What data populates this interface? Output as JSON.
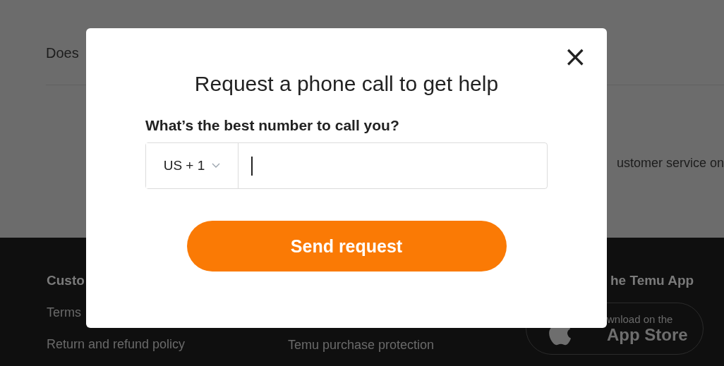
{
  "background": {
    "question": "Does",
    "snippet": "ustomer service on"
  },
  "footer": {
    "heading_1": "Custo",
    "links_1": [
      "Terms",
      "Return and refund policy"
    ],
    "links_2": [
      "Temu purchase protection"
    ],
    "heading_3": "he Temu App",
    "app_badge": {
      "caption": "wnload on the",
      "store": "App Store"
    }
  },
  "dialog": {
    "close": "×",
    "title": "Request a phone call to get help",
    "field_label": "What’s the best number to call you?",
    "country_code": "US + 1",
    "phone_focused": true,
    "button": "Send request"
  }
}
